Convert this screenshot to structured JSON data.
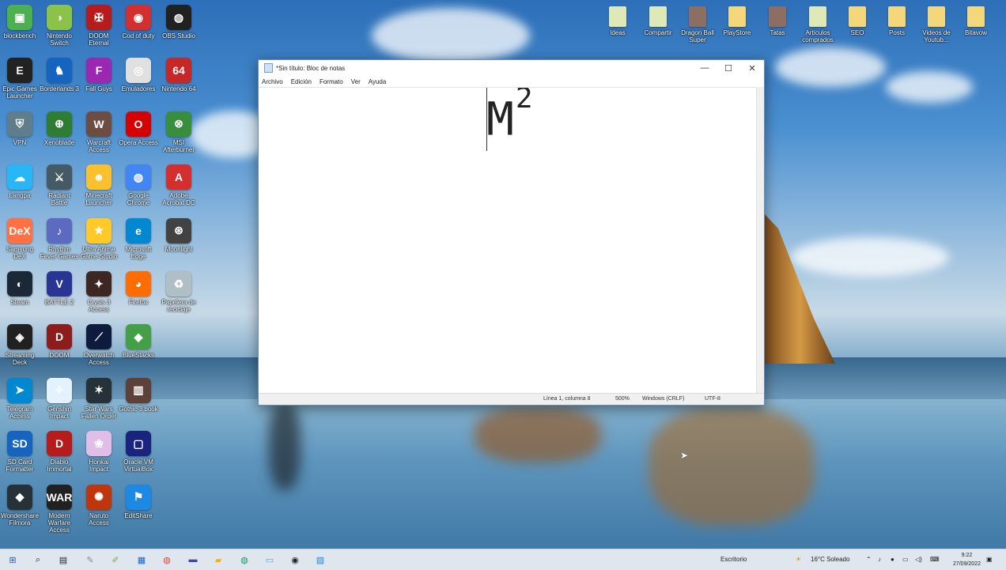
{
  "desktop": {
    "left_icons": [
      {
        "label": "blockbench",
        "color": "#4caf50",
        "glyph": "▣"
      },
      {
        "label": "Nintendo Switch",
        "color": "#8bc34a",
        "glyph": "◑"
      },
      {
        "label": "DOOM Eternal",
        "color": "#b71c1c",
        "glyph": "✠"
      },
      {
        "label": "Cod of duty",
        "color": "#d32f2f",
        "glyph": "◉"
      },
      {
        "label": "OBS Studio",
        "color": "#212121",
        "glyph": "◍"
      },
      {
        "label": "Epic Games Launcher",
        "color": "#222",
        "glyph": "E"
      },
      {
        "label": "Borderlands 3",
        "color": "#1565c0",
        "glyph": "♞"
      },
      {
        "label": "Fall Guys",
        "color": "#9c27b0",
        "glyph": "F"
      },
      {
        "label": "Emuladores",
        "color": "#e0e0e0",
        "glyph": "◎"
      },
      {
        "label": "Nintendo 64",
        "color": "#c62828",
        "glyph": "64"
      },
      {
        "label": "VPN",
        "color": "#607d8b",
        "glyph": "⛨"
      },
      {
        "label": "Xenoblade",
        "color": "#2e7d32",
        "glyph": "⊕"
      },
      {
        "label": "Warcraft Access",
        "color": "#6d4c41",
        "glyph": "W"
      },
      {
        "label": "Opera Access",
        "color": "#d50000",
        "glyph": "O"
      },
      {
        "label": "MSI Afterburner",
        "color": "#388e3c",
        "glyph": "⊗"
      },
      {
        "label": "Langpa",
        "color": "#29b6f6",
        "glyph": "☁"
      },
      {
        "label": "Radiant Battle",
        "color": "#455a64",
        "glyph": "⚔"
      },
      {
        "label": "Minecraft Launcher",
        "color": "#fbc02d",
        "glyph": "☻"
      },
      {
        "label": "Google Chrome",
        "color": "#4285f4",
        "glyph": "◍"
      },
      {
        "label": "Adobe Acrobat DC",
        "color": "#d32f2f",
        "glyph": "A"
      },
      {
        "label": "Samsung DeX",
        "color": "#ff7043",
        "glyph": "DeX"
      },
      {
        "label": "Rhythm Fever Games",
        "color": "#5c6bc0",
        "glyph": "♪"
      },
      {
        "label": "Ultra Anime Game Studio",
        "color": "#ffca28",
        "glyph": "★"
      },
      {
        "label": "Microsoft Edge",
        "color": "#0288d1",
        "glyph": "e"
      },
      {
        "label": "Moonlight",
        "color": "#424242",
        "glyph": "⊛"
      },
      {
        "label": "Steam",
        "color": "#1b2838",
        "glyph": "◐"
      },
      {
        "label": "BATTLE 2",
        "color": "#283593",
        "glyph": "V"
      },
      {
        "label": "Crysis 3 Access",
        "color": "#3e2723",
        "glyph": "✦"
      },
      {
        "label": "Firefox",
        "color": "#ff6d00",
        "glyph": "◕"
      },
      {
        "label": "Papelera de reciclaje",
        "color": "#b0bec5",
        "glyph": "♻"
      },
      {
        "label": "Streaming Deck",
        "color": "#212121",
        "glyph": "◈"
      },
      {
        "label": "DOOM",
        "color": "#8d1c1c",
        "glyph": "D"
      },
      {
        "label": "Overwatch Access",
        "color": "#0d1b3d",
        "glyph": "⟋"
      },
      {
        "label": "BlueStacks",
        "color": "#43a047",
        "glyph": "◆"
      },
      {
        "label": "",
        "color": "#fff",
        "glyph": ""
      },
      {
        "label": "Telegram Access",
        "color": "#0288d1",
        "glyph": "➤"
      },
      {
        "label": "Genshin Impact",
        "color": "#e3f2fd",
        "glyph": "✧"
      },
      {
        "label": "Star Wars Fallen Order",
        "color": "#263238",
        "glyph": "✶"
      },
      {
        "label": "Gothic 3 book",
        "color": "#5d4037",
        "glyph": "▥"
      },
      {
        "label": "",
        "color": "#fff",
        "glyph": ""
      },
      {
        "label": "SD Card Formatter",
        "color": "#1565c0",
        "glyph": "SD"
      },
      {
        "label": "Diablo Immortal",
        "color": "#b71c1c",
        "glyph": "D"
      },
      {
        "label": "Honkai Impact",
        "color": "#e1bee7",
        "glyph": "❀"
      },
      {
        "label": "Oracle VM VirtualBox",
        "color": "#1a237e",
        "glyph": "▢"
      },
      {
        "label": "",
        "color": "#fff",
        "glyph": ""
      },
      {
        "label": "Wondershare Filmora",
        "color": "#263238",
        "glyph": "◆"
      },
      {
        "label": "Modern Warfare Access",
        "color": "#212121",
        "glyph": "WAR"
      },
      {
        "label": "Naruto Access",
        "color": "#bf360c",
        "glyph": "✺"
      },
      {
        "label": "EditShare",
        "color": "#1e88e5",
        "glyph": "⚑"
      }
    ],
    "top_right_icons": [
      {
        "label": "Ideas",
        "type": "doc"
      },
      {
        "label": "Compartir",
        "type": "doc"
      },
      {
        "label": "Dragon Ball Super",
        "type": "img"
      },
      {
        "label": "PlayStore",
        "type": "folder"
      },
      {
        "label": "Tatas",
        "type": "img"
      },
      {
        "label": "Artículos comprados",
        "type": "doc"
      },
      {
        "label": "SEO",
        "type": "folder"
      },
      {
        "label": "Posts",
        "type": "folder"
      },
      {
        "label": "Videos de Youtub...",
        "type": "folder"
      },
      {
        "label": "Bitavow",
        "type": "folder"
      }
    ]
  },
  "notepad": {
    "title": "*Sin título: Bloc de notas",
    "menu": [
      "Archivo",
      "Edición",
      "Formato",
      "Ver",
      "Ayuda"
    ],
    "content_main": "M",
    "content_sup": "2",
    "status": {
      "position": "Línea 1, columna 8",
      "zoom": "500%",
      "eol": "Windows (CRLF)",
      "encoding": "UTF-8"
    },
    "controls": {
      "minimize": "—",
      "maximize": "☐",
      "close": "✕"
    }
  },
  "taskbar": {
    "search_label": "Escritorio",
    "weather": "16°C  Soleado",
    "time": "9:22",
    "date": "27/09/2022",
    "apps": [
      {
        "name": "start",
        "glyph": "⊞",
        "color": "#1f5fb0"
      },
      {
        "name": "search",
        "glyph": "⌕",
        "color": "#222"
      },
      {
        "name": "task-view",
        "glyph": "▤",
        "color": "#222"
      },
      {
        "name": "tool",
        "glyph": "✎",
        "color": "#888"
      },
      {
        "name": "notepadpp",
        "glyph": "✐",
        "color": "#6ab04c"
      },
      {
        "name": "store",
        "glyph": "▦",
        "color": "#1565c0"
      },
      {
        "name": "chrome",
        "glyph": "◍",
        "color": "#db4437"
      },
      {
        "name": "remote",
        "glyph": "▬",
        "color": "#3949ab"
      },
      {
        "name": "files",
        "glyph": "▰",
        "color": "#f4b400"
      },
      {
        "name": "chrome2",
        "glyph": "◍",
        "color": "#0f9d58"
      },
      {
        "name": "notepad",
        "glyph": "▭",
        "color": "#4fa3e0"
      },
      {
        "name": "obs",
        "glyph": "◉",
        "color": "#222"
      },
      {
        "name": "photos",
        "glyph": "▨",
        "color": "#1e88e5"
      }
    ]
  }
}
